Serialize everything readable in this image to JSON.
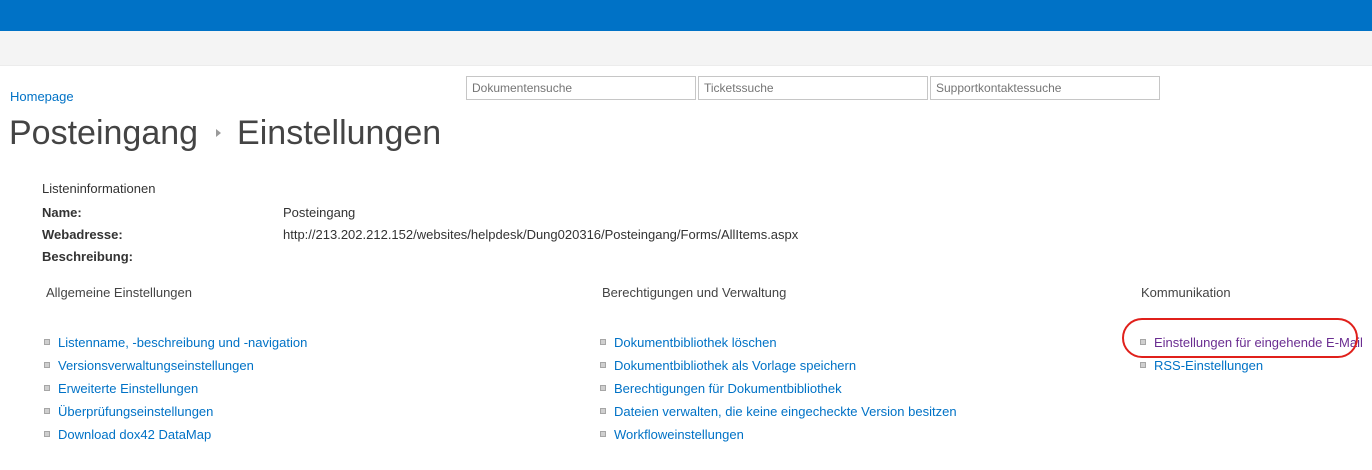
{
  "breadcrumb": {
    "home_label": "Homepage"
  },
  "search": {
    "documents_placeholder": "Dokumentensuche",
    "tickets_placeholder": "Ticketssuche",
    "support_placeholder": "Supportkontaktessuche"
  },
  "title": {
    "list_name": "Posteingang",
    "page": "Einstellungen"
  },
  "list_info": {
    "heading": "Listeninformationen",
    "name_label": "Name:",
    "name_value": "Posteingang",
    "url_label": "Webadresse:",
    "url_value": "http://213.202.212.152/websites/helpdesk/Dung020316/Posteingang/Forms/AllItems.aspx",
    "description_label": "Beschreibung:"
  },
  "sections": {
    "general": {
      "title": "Allgemeine Einstellungen",
      "items": [
        "Listenname, -beschreibung und -navigation",
        "Versionsverwaltungseinstellungen",
        "Erweiterte Einstellungen",
        "Überprüfungseinstellungen",
        "Download dox42 DataMap"
      ]
    },
    "permissions": {
      "title": "Berechtigungen und Verwaltung",
      "items": [
        "Dokumentbibliothek löschen",
        "Dokumentbibliothek als Vorlage speichern",
        "Berechtigungen für Dokumentbibliothek",
        "Dateien verwalten, die keine eingecheckte Version besitzen",
        "Workfloweinstellungen"
      ]
    },
    "communication": {
      "title": "Kommunikation",
      "items": [
        "Einstellungen für eingehende E-Mail",
        "RSS-Einstellungen"
      ]
    }
  },
  "colors": {
    "suite_bar": "#0072c6",
    "link": "#0072c6",
    "visited_link": "#6a2d91",
    "highlight": "#e0201b"
  }
}
